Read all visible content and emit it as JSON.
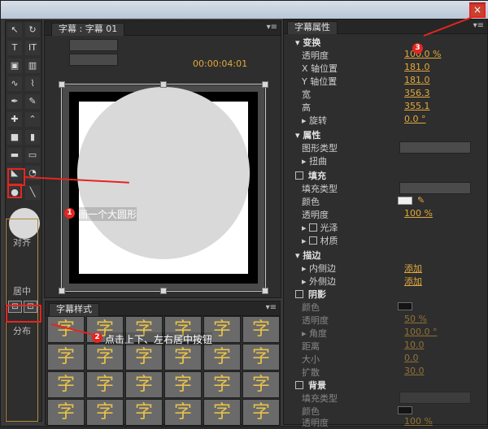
{
  "window": {
    "close_glyph": "×"
  },
  "tabs": {
    "left_tab": "字幕 : 字幕 01",
    "props_tab": "字幕属性",
    "styles_tab": "字幕样式"
  },
  "timecode": "00:00:04:01",
  "align_panel": {
    "title": "对齐",
    "center_label": "居中",
    "distribute_label": "分布"
  },
  "properties": {
    "transform": {
      "section": "变换",
      "opacity_label": "透明度",
      "opacity_value": "100.0 %",
      "x_label": "X 轴位置",
      "x_value": "181.0",
      "y_label": "Y 轴位置",
      "y_value": "181.0",
      "width_label": "宽",
      "width_value": "356.3",
      "height_label": "高",
      "height_value": "355.1",
      "rotation_label": "旋转",
      "rotation_value": "0.0 °"
    },
    "attributes": {
      "section": "属性",
      "graphic_type_label": "图形类型",
      "distort_label": "扭曲"
    },
    "fill": {
      "section": "填充",
      "fill_type_label": "填充类型",
      "color_label": "颜色",
      "color_value": "#f0f0f0",
      "opacity_label": "透明度",
      "opacity_value": "100 %",
      "sheen_label": "光泽",
      "texture_label": "材质"
    },
    "stroke": {
      "section": "描边",
      "inner_label": "内侧边",
      "inner_add": "添加",
      "outer_label": "外侧边",
      "outer_add": "添加"
    },
    "shadow": {
      "section": "阴影",
      "color_label": "颜色",
      "color_value": "#000000",
      "opacity_label": "透明度",
      "opacity_value": "50 %",
      "angle_label": "角度",
      "angle_value": "100.0 °",
      "distance_label": "距离",
      "distance_value": "10.0",
      "size_label": "大小",
      "size_value": "0.0",
      "spread_label": "扩散",
      "spread_value": "30.0"
    },
    "background": {
      "section": "背景",
      "fill_type_label": "填充类型",
      "color_label": "颜色",
      "color_value": "#000000",
      "opacity_label": "透明度",
      "opacity_value": "100 %"
    }
  },
  "annotations": {
    "step1_num": "1",
    "step1": "画一个大圆形",
    "step2_num": "2",
    "step2": "点击上下、左右居中按钮",
    "step3_num": "3"
  },
  "style_glyph": "字"
}
